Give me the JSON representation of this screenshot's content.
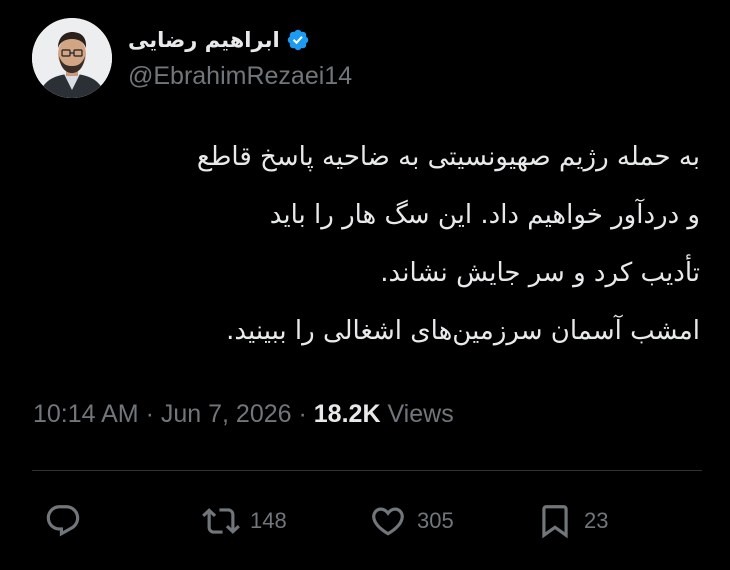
{
  "author": {
    "display_name": "ابراهیم رضایی",
    "handle": "@EbrahimRezaei14",
    "verified": true,
    "avatar_icon": "profile-photo"
  },
  "tweet": {
    "lines": [
      "به حمله رژیم صهیونسیتی به ضاحیه پاسخ قاطع",
      "و دردآور خواهیم داد. این سگ هار را باید",
      "تأدیب کرد و سر جایش نشاند.",
      "امشب آسمان سرزمین‌های اشغالی را ببینید."
    ],
    "time": "10:14 AM",
    "separator": "·",
    "date": "Jun 7, 2026",
    "views_count": "18.2K",
    "views_label": "Views"
  },
  "actions": {
    "reply": {
      "icon": "reply-icon",
      "count": ""
    },
    "retweet": {
      "icon": "retweet-icon",
      "count": "148"
    },
    "like": {
      "icon": "heart-icon",
      "count": "305"
    },
    "bookmark": {
      "icon": "bookmark-icon",
      "count": "23"
    }
  },
  "colors": {
    "background": "#000000",
    "text": "#e7e9ea",
    "muted": "#71767b",
    "verified": "#1d9bf0",
    "divider": "#2f3336"
  }
}
